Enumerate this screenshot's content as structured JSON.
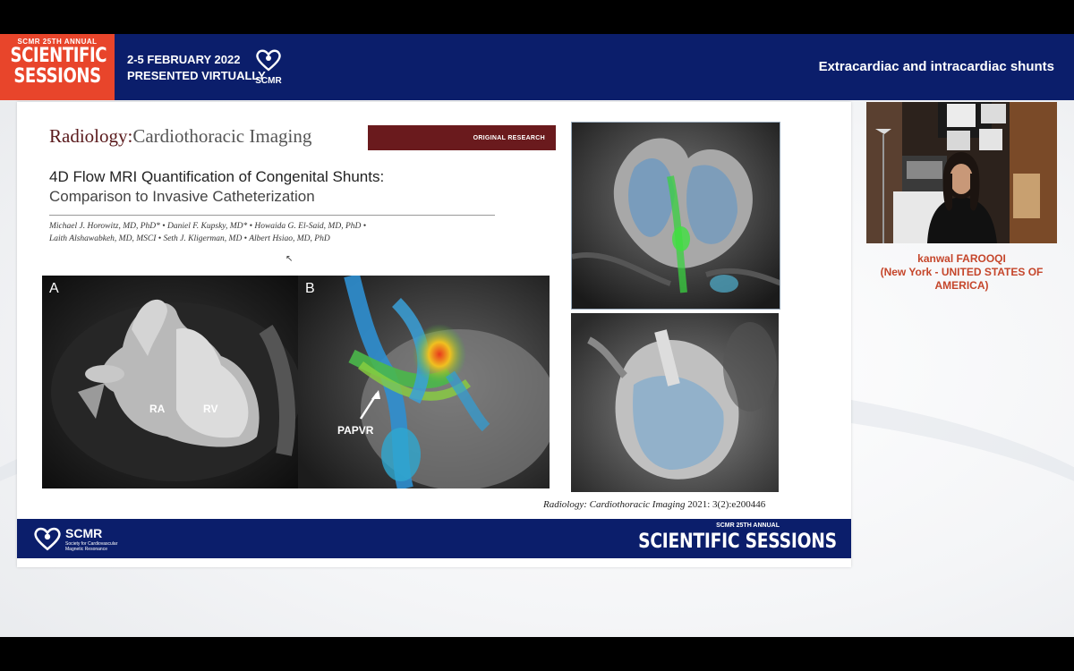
{
  "banner": {
    "logo_small": "SCMR 25TH ANNUAL",
    "logo_line1": "SCIENTIFIC",
    "logo_line2": "SESSIONS",
    "dates_line1": "2-5 FEBRUARY 2022",
    "dates_line2": "PRESENTED VIRTUALLY",
    "org_mark": "SCMR",
    "session_title": "Extracardiac and intracardiac shunts"
  },
  "slide": {
    "journal_name": "Radiology:",
    "journal_section": "Cardiothoracic Imaging",
    "tag": "ORIGINAL RESEARCH",
    "title": "4D Flow MRI Quantification of Congenital Shunts:",
    "subtitle": "Comparison to Invasive Catheterization",
    "authors_line1": "Michael J. Horowitz, MD, PhD* • Daniel F. Kupsky, MD* • Howaida G. El-Said, MD, PhD •",
    "authors_line2": "Laith Alshawabkeh, MD, MSCI • Seth J. Kligerman, MD • Albert Hsiao, MD, PhD",
    "panel_a": "A",
    "panel_b": "B",
    "label_ra": "RA",
    "label_rv": "RV",
    "label_papvr": "PAPVR",
    "citation_journal": "Radiology: Cardiothoracic Imaging",
    "citation_ref": "2021: 3(2):e200446",
    "footer_org": "SCMR",
    "footer_org_desc": "Society for Cardiovascular Magnetic Resonance",
    "footer_small": "SCMR 25TH ANNUAL",
    "footer_big": "SCIENTIFIC SESSIONS"
  },
  "presenter": {
    "name": "kanwal FAROOQI",
    "location": "(New York - UNITED STATES OF AMERICA)"
  },
  "colors": {
    "banner_blue": "#0b1e6b",
    "logo_orange": "#e8452b",
    "journal_maroon": "#6a1a1d",
    "presenter_text": "#c5462b"
  }
}
